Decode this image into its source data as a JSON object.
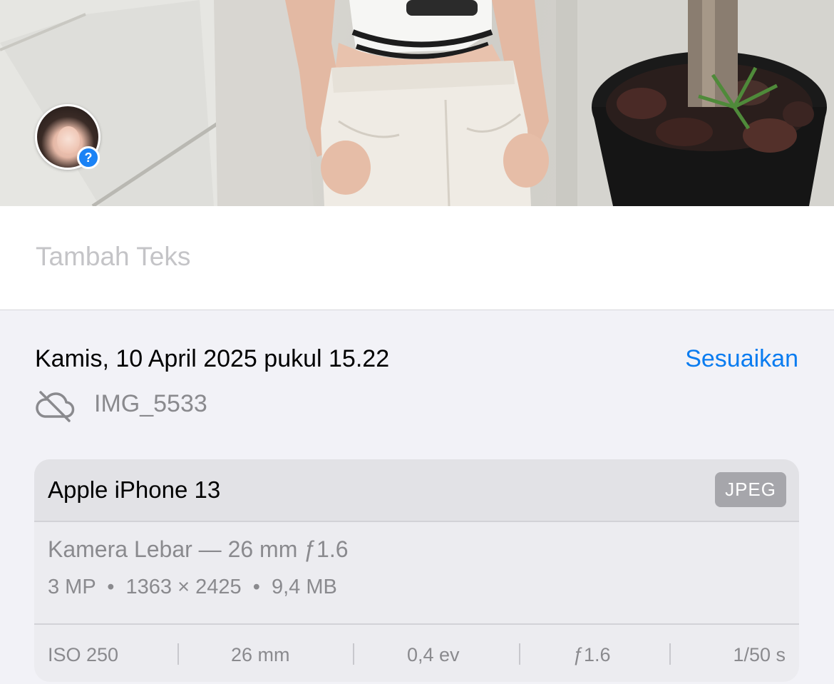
{
  "caption": {
    "placeholder": "Tambah Teks"
  },
  "info": {
    "datetime": "Kamis, 10 April 2025 pukul 15.22",
    "adjust_label": "Sesuaikan",
    "filename": "IMG_5533"
  },
  "camera": {
    "device": "Apple iPhone 13",
    "format": "JPEG",
    "lens": "Kamera Lebar — 26 mm ƒ1.6",
    "specs": "3 MP  •  1363 × 2425  •  9,4 MB",
    "exif": {
      "iso": "ISO 250",
      "focal": "26 mm",
      "ev": "0,4 ev",
      "aperture": "ƒ1.6",
      "shutter": "1/50 s"
    }
  },
  "colors": {
    "accent": "#0a7cf0",
    "badge": "#1a82f5"
  },
  "icons": {
    "cloud": "cloud-slash-icon",
    "badge": "question-badge-icon"
  }
}
